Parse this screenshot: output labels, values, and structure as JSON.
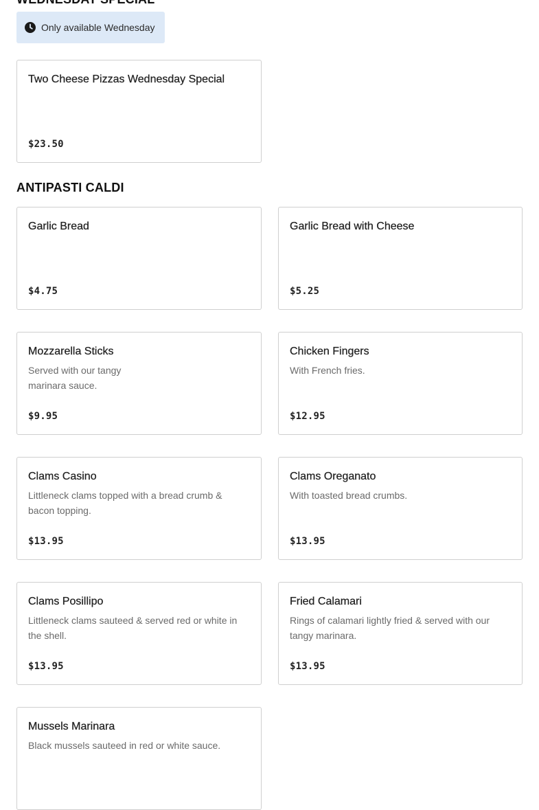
{
  "wednesday_special": {
    "title": "WEDNESDAY SPECIAL",
    "notice": {
      "icon": "clock-icon",
      "text": "Only available Wednesday"
    },
    "items": [
      {
        "name": "Two Cheese Pizzas Wednesday Special",
        "description": "",
        "price": "$23.50"
      }
    ]
  },
  "antipasti_caldi": {
    "title": "ANTIPASTI CALDI",
    "items": [
      {
        "name": "Garlic Bread",
        "description": "",
        "price": "$4.75"
      },
      {
        "name": "Garlic Bread with Cheese",
        "description": "",
        "price": "$5.25"
      },
      {
        "name": "Mozzarella Sticks",
        "description": "Served with our tangy marinara sauce.",
        "price": "$9.95"
      },
      {
        "name": "Chicken Fingers",
        "description": "With French fries.",
        "price": "$12.95"
      },
      {
        "name": "Clams Casino",
        "description": "Littleneck clams topped with a bread crumb & bacon topping.",
        "price": "$13.95"
      },
      {
        "name": "Clams Oreganato",
        "description": "With toasted bread crumbs.",
        "price": "$13.95"
      },
      {
        "name": "Clams Posillipo",
        "description": "Littleneck clams sauteed & served red or white in the shell.",
        "price": "$13.95"
      },
      {
        "name": "Fried Calamari",
        "description": "Rings of calamari lightly fried & served with our tangy marinara.",
        "price": "$13.95"
      },
      {
        "name": "Mussels Marinara",
        "description": "Black mussels sauteed in red or white sauce.",
        "price": ""
      }
    ]
  }
}
